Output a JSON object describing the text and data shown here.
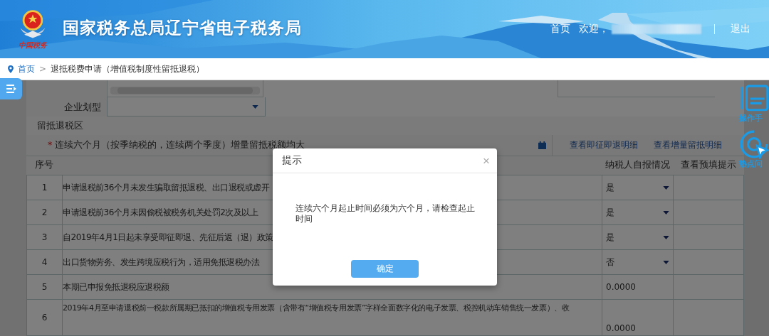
{
  "header": {
    "logo_caption": "中国税务",
    "title": "国家税务总局辽宁省电子税务局",
    "home_link": "首页",
    "welcome": "欢迎，",
    "logout": "退出"
  },
  "breadcrumb": {
    "home": "首页",
    "separator": ">",
    "current": "退抵税费申请（增值税制度性留抵退税）"
  },
  "form": {
    "field_label": "企业划型",
    "section_title": "留抵退税区",
    "required_mark": "*",
    "required_note": "连续六个月（按季纳税的，连续两个季度）增量留抵税额均大",
    "links": [
      "查看即征即退明细",
      "查看增量留抵明细"
    ]
  },
  "table": {
    "columns": [
      "序号",
      "纳税人自报情况",
      "查看预填提示"
    ],
    "rows": [
      {
        "no": "1",
        "item": "申请退税前36个月未发生骗取留抵退税、出口退税或虚开",
        "kind": "select",
        "value": "是"
      },
      {
        "no": "2",
        "item": "申请退税前36个月未因偷税被税务机关处罚2次及以上",
        "kind": "select",
        "value": "是"
      },
      {
        "no": "3",
        "item": "自2019年4月1日起未享受即征即退、先征后返（退）政策",
        "kind": "select",
        "value": "是"
      },
      {
        "no": "4",
        "item": "出口货物劳务、发生跨境应税行为，适用免抵退税办法",
        "kind": "select",
        "value": "否"
      },
      {
        "no": "5",
        "item": "本期已申报免抵退税应退税额",
        "kind": "amount",
        "value": "0.0000"
      },
      {
        "no": "6",
        "item": "2019年4月至申请退税前一税款所属期已抵扣的增值税专用发票（含带有“增值税专用发票”字样全面数字化的电子发票、税控机动车销售统一发票）、收",
        "kind": "amount",
        "value": "0.0000"
      }
    ]
  },
  "side_tools": [
    {
      "label": "操作手"
    },
    {
      "label": "热点问"
    }
  ],
  "dialog": {
    "title": "提示",
    "close": "×",
    "message": "连续六个月起止时间必须为六个月，请检查起止时间",
    "button": "确定"
  }
}
